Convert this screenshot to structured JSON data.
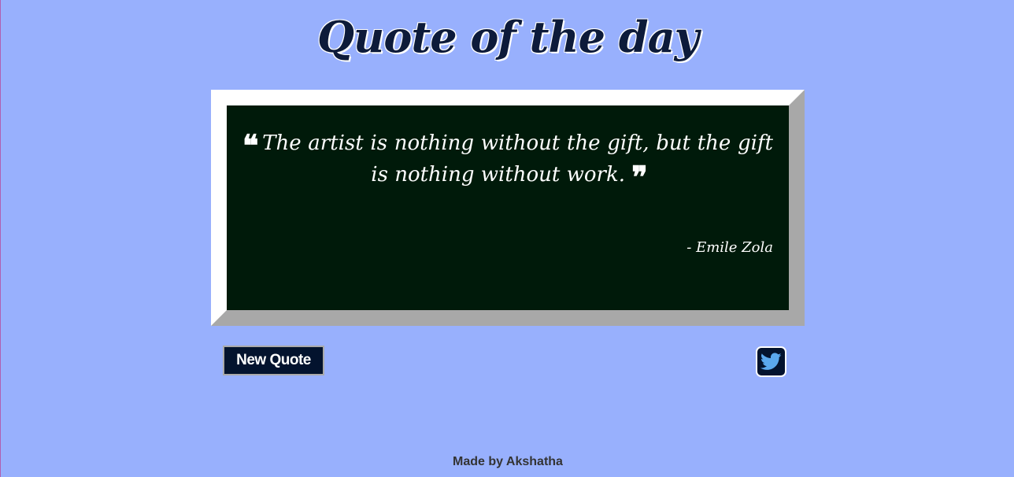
{
  "header": {
    "title": "Quote of the day"
  },
  "quote": {
    "open_mark": "❝",
    "text": "The artist is nothing without the gift, but the gift is nothing without work.",
    "close_mark": "❞",
    "author": "- Emile Zola"
  },
  "actions": {
    "new_quote_label": "New Quote",
    "tweet_icon": "twitter-icon"
  },
  "footer": {
    "text": "Made by Akshatha"
  },
  "colors": {
    "background": "#98b0fd",
    "board": "#001a0a",
    "button": "#03132e",
    "twitter_bird": "#5aa8ee"
  }
}
